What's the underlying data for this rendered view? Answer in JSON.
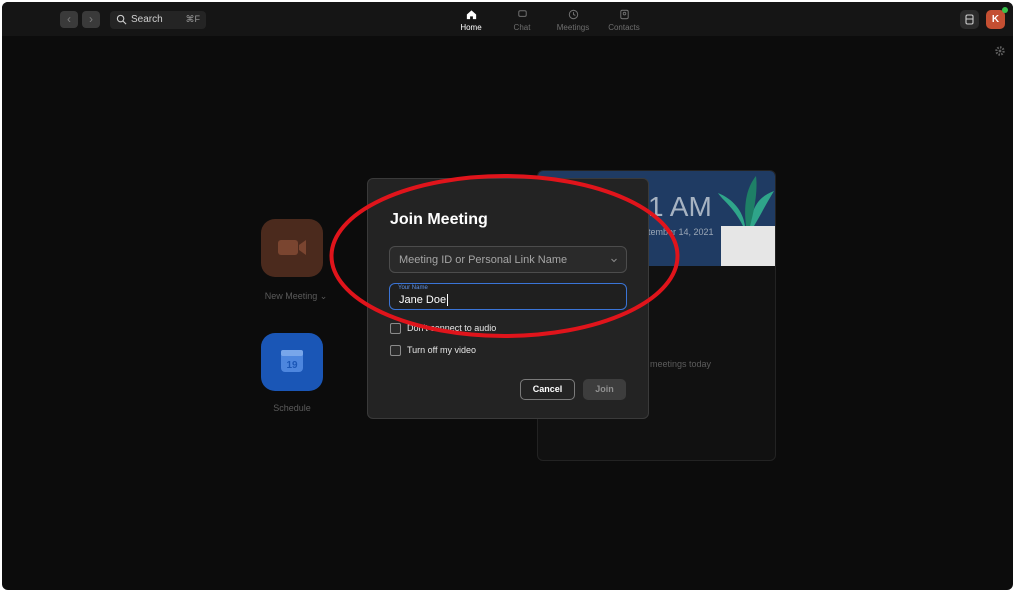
{
  "topbar": {
    "search_label": "Search",
    "search_shortcut": "⌘F",
    "tabs": [
      {
        "label": "Home",
        "icon": "home-icon",
        "active": true
      },
      {
        "label": "Chat",
        "icon": "chat-icon",
        "active": false
      },
      {
        "label": "Meetings",
        "icon": "clock-icon",
        "active": false
      },
      {
        "label": "Contacts",
        "icon": "contacts-icon",
        "active": false
      }
    ],
    "avatar_initial": "K"
  },
  "home": {
    "new_meeting_label": "New Meeting",
    "schedule_label": "Schedule",
    "calendar_day": "19"
  },
  "card": {
    "time_fragment": "1 AM",
    "date_fragment": "tember 14, 2021",
    "empty_fragment": "meetings today"
  },
  "dialog": {
    "title": "Join Meeting",
    "meeting_id_placeholder": "Meeting ID or Personal Link Name",
    "name_label": "Your Name",
    "name_value": "Jane Doe",
    "options": [
      {
        "label": "Don't connect to audio",
        "checked": false
      },
      {
        "label": "Turn off my video",
        "checked": false
      }
    ],
    "cancel_label": "Cancel",
    "join_label": "Join"
  },
  "colors": {
    "accent": "#3a74d6",
    "annotation": "#e0141b",
    "new_meeting": "#4b2a1d",
    "schedule": "#1a56b6",
    "presence": "#37c24b"
  }
}
